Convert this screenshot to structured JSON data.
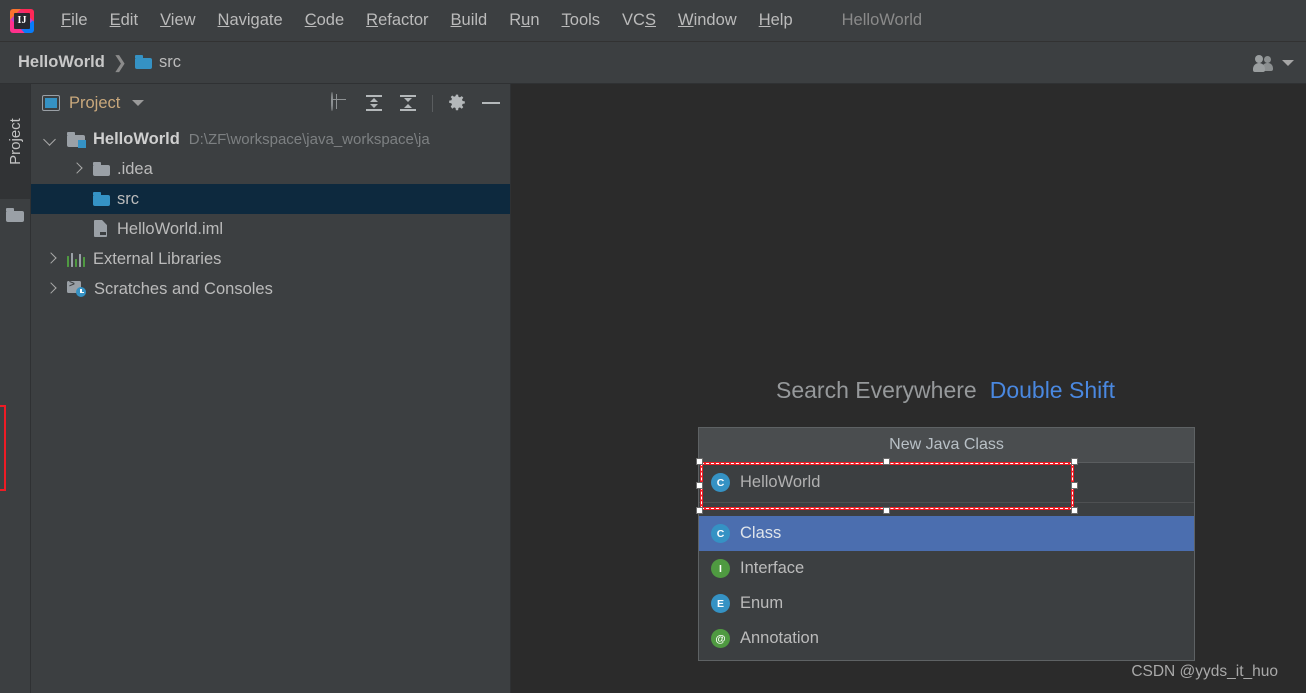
{
  "window": {
    "title": "HelloWorld",
    "logo_text": "IJ"
  },
  "menubar": {
    "items": [
      {
        "label": "File",
        "mnemonic": "F"
      },
      {
        "label": "Edit",
        "mnemonic": "E"
      },
      {
        "label": "View",
        "mnemonic": "V"
      },
      {
        "label": "Navigate",
        "mnemonic": "N"
      },
      {
        "label": "Code",
        "mnemonic": "C"
      },
      {
        "label": "Refactor",
        "mnemonic": "R"
      },
      {
        "label": "Build",
        "mnemonic": "B"
      },
      {
        "label": "Run",
        "mnemonic": "u"
      },
      {
        "label": "Tools",
        "mnemonic": "T"
      },
      {
        "label": "VCS",
        "mnemonic": "S"
      },
      {
        "label": "Window",
        "mnemonic": "W"
      },
      {
        "label": "Help",
        "mnemonic": "H"
      }
    ]
  },
  "navbar": {
    "crumbs": [
      {
        "label": "HelloWorld",
        "icon": null
      },
      {
        "label": "src",
        "icon": "folder-icon"
      }
    ],
    "separator": "❯",
    "right_icons": [
      "people-icon",
      "chevron-down-icon"
    ]
  },
  "stripe": {
    "tab_label": "Project",
    "icons": [
      "folder-icon"
    ]
  },
  "project_panel": {
    "title": "Project",
    "title_icon": "project-view-icon",
    "dropdown_icon": "chevron-down-icon",
    "tools": [
      "locate-target-icon",
      "expand-all-icon",
      "collapse-all-icon",
      "settings-gear-icon",
      "hide-panel-icon"
    ],
    "tree": [
      {
        "label": "HelloWorld",
        "path": "D:\\ZF\\workspace\\java_workspace\\ja",
        "icon": "module-icon",
        "arrow": "open",
        "indent": 0,
        "bold": true,
        "selected": false
      },
      {
        "label": ".idea",
        "path": "",
        "icon": "folder-icon-grey",
        "arrow": "closed",
        "indent": 1,
        "bold": false,
        "selected": false
      },
      {
        "label": "src",
        "path": "",
        "icon": "folder-icon-blue",
        "arrow": "none",
        "indent": 1,
        "bold": false,
        "selected": true
      },
      {
        "label": "HelloWorld.iml",
        "path": "",
        "icon": "iml-file-icon",
        "arrow": "none",
        "indent": 1,
        "bold": false,
        "selected": false
      },
      {
        "label": "External Libraries",
        "path": "",
        "icon": "libraries-icon",
        "arrow": "closed",
        "indent": 0,
        "bold": false,
        "selected": false
      },
      {
        "label": "Scratches and Consoles",
        "path": "",
        "icon": "scratches-icon",
        "arrow": "closed",
        "indent": 0,
        "bold": false,
        "selected": false
      }
    ]
  },
  "editor": {
    "search_hint_label": "Search Everywhere",
    "search_hint_key": "Double Shift",
    "watermark": "CSDN @yyds_it_huo"
  },
  "new_class_popup": {
    "header": "New Java Class",
    "input_value": "HelloWorld",
    "input_icon": "class-icon",
    "items": [
      {
        "label": "Class",
        "icon": "class-icon",
        "badge": "C",
        "badge_color": "#3592c4",
        "selected": true
      },
      {
        "label": "Interface",
        "icon": "interface-icon",
        "badge": "I",
        "badge_color": "#4f9a41",
        "selected": false
      },
      {
        "label": "Enum",
        "icon": "enum-icon",
        "badge": "E",
        "badge_color": "#3592c4",
        "selected": false
      },
      {
        "label": "Annotation",
        "icon": "annotation-icon",
        "badge": "@",
        "badge_color": "#4f9a41",
        "selected": false
      }
    ]
  },
  "annotations": {
    "highlight_color": "#ee1c25",
    "boxes": [
      "left-edge-marker",
      "class-name-input-selection"
    ]
  },
  "colors": {
    "panel_bg": "#3c3f41",
    "editor_bg": "#2b2b2b",
    "tree_selection": "#0d293e",
    "list_selection": "#4b6eaf",
    "accent_blue": "#3592c4",
    "hint_key_blue": "#4a88e0",
    "text_primary": "#bbbbbb",
    "text_muted": "#7d8082",
    "title_gold": "#c9a87c",
    "annotation_red": "#ee1c25"
  },
  "library_bars": [
    {
      "color": "#4f9a41",
      "height": 11
    },
    {
      "color": "#9aa0a6",
      "height": 14
    },
    {
      "color": "#4f9a41",
      "height": 8
    },
    {
      "color": "#9aa0a6",
      "height": 13
    },
    {
      "color": "#4f9a41",
      "height": 10
    }
  ]
}
